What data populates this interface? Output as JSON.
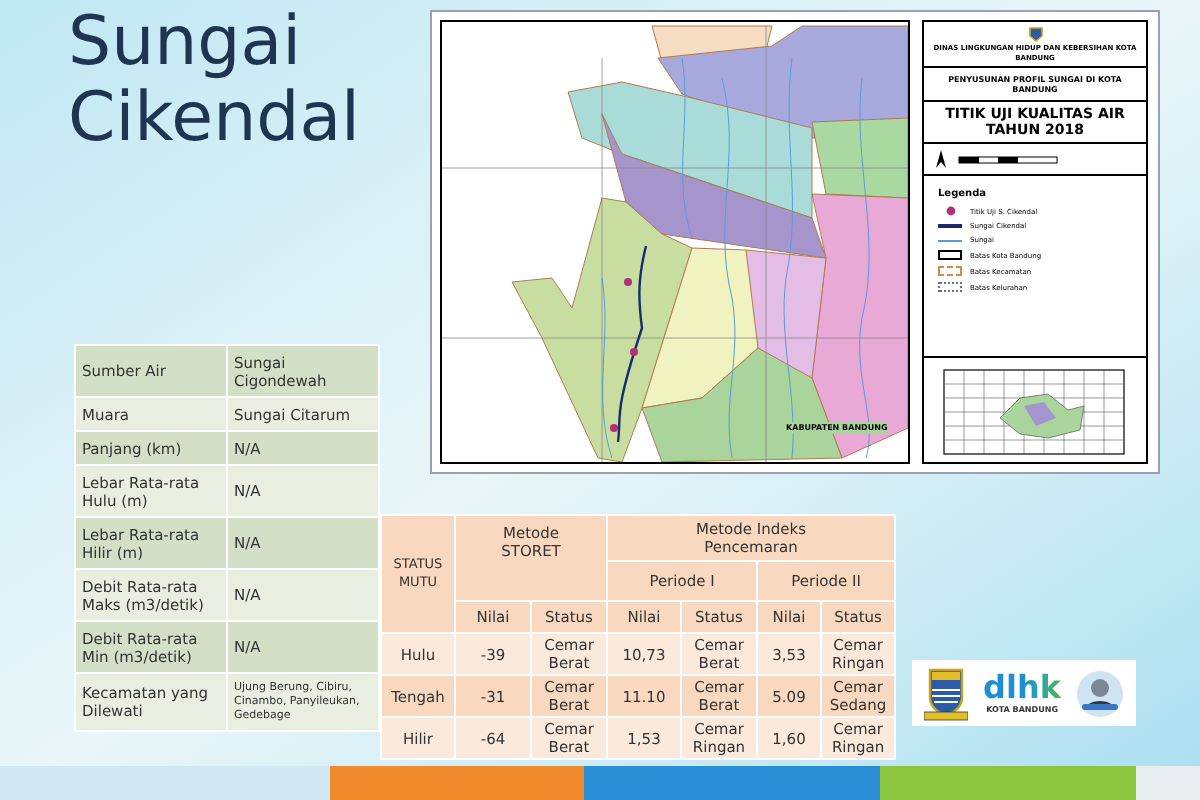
{
  "title": "Sungai Cikendal",
  "map": {
    "institution": "DINAS LINGKUNGAN HIDUP DAN KEBERSIHAN KOTA BANDUNG",
    "project": "PENYUSUNAN PROFIL SUNGAI DI KOTA BANDUNG",
    "map_title": "TITIK UJI KUALITAS AIR TAHUN 2018",
    "region_label": "KABUPATEN BANDUNG",
    "legend_title": "Legenda",
    "legend": [
      {
        "kind": "point",
        "label": "Titik Uji S. Cikendal"
      },
      {
        "kind": "river-main",
        "label": "Sungai Cikendal"
      },
      {
        "kind": "river",
        "label": "Sungai"
      },
      {
        "kind": "city-border",
        "label": "Batas Kota Bandung"
      },
      {
        "kind": "district-border",
        "label": "Batas Kecamatan"
      },
      {
        "kind": "village-border",
        "label": "Batas Kelurahan"
      }
    ]
  },
  "profile": [
    {
      "label": "Sumber Air",
      "value": "Sungai Cigondewah"
    },
    {
      "label": "Muara",
      "value": "Sungai Citarum"
    },
    {
      "label": "Panjang (km)",
      "value": "N/A"
    },
    {
      "label": "Lebar Rata-rata Hulu (m)",
      "value": "N/A"
    },
    {
      "label": "Lebar Rata-rata Hilir (m)",
      "value": "N/A"
    },
    {
      "label": "Debit Rata-rata Maks (m3/detik)",
      "value": "N/A"
    },
    {
      "label": "Debit Rata-rata Min (m3/detik)",
      "value": "N/A"
    },
    {
      "label": "Kecamatan yang Dilewati",
      "value": "Ujung Berung, Cibiru, Cinambo, Panyileukan, Gedebage",
      "small": true
    }
  ],
  "quality": {
    "status_header": "STATUS MUTU",
    "storet_header": "Metode STORET",
    "ip_header": "Metode Indeks Pencemaran",
    "periods": [
      "Periode I",
      "Periode II"
    ],
    "subheaders": [
      "Nilai",
      "Status",
      "Nilai",
      "Status",
      "Nilai",
      "Status"
    ],
    "rows": [
      {
        "location": "Hulu",
        "cells": [
          "-39",
          "Cemar Berat",
          "10,73",
          "Cemar Berat",
          "3,53",
          "Cemar Ringan"
        ]
      },
      {
        "location": "Tengah",
        "cells": [
          "-31",
          "Cemar Berat",
          "11.10",
          "Cemar Berat",
          "5.09",
          "Cemar Sedang"
        ]
      },
      {
        "location": "Hilir",
        "cells": [
          "-64",
          "Cemar Berat",
          "1,53",
          "Cemar Ringan",
          "1,60",
          "Cemar Ringan"
        ]
      }
    ]
  },
  "logos": {
    "agency": "dlhk",
    "agency_city": "KOTA BANDUNG"
  }
}
